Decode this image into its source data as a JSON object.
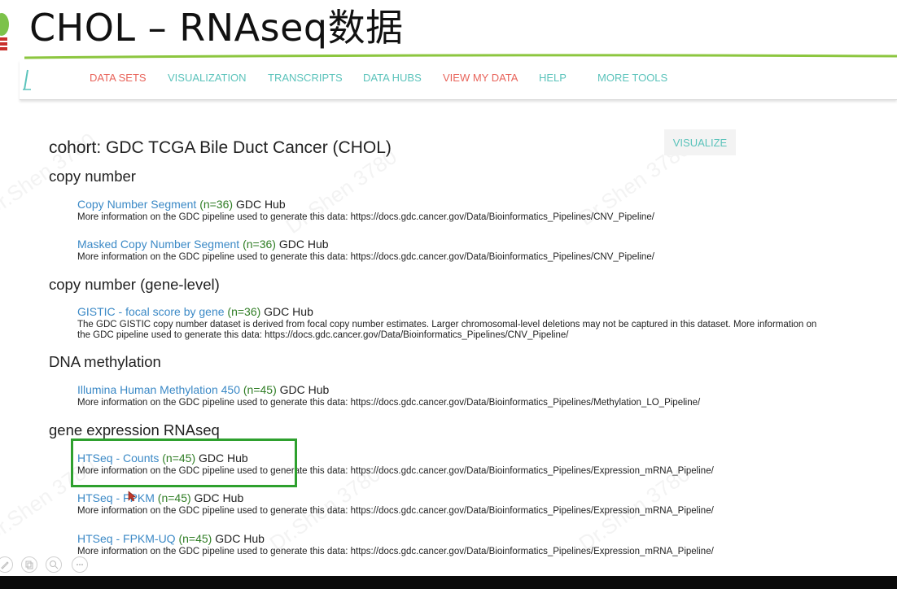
{
  "slide": {
    "title": "CHOL – RNAseq数据"
  },
  "nav": {
    "items": [
      {
        "label": "DATA SETS",
        "color": "#e8635a"
      },
      {
        "label": "VISUALIZATION",
        "color": "#5bc3bb"
      },
      {
        "label": "TRANSCRIPTS",
        "color": "#5bc3bb"
      },
      {
        "label": "DATA HUBS",
        "color": "#5bc3bb"
      },
      {
        "label": "VIEW MY DATA",
        "color": "#e8635a"
      },
      {
        "label": "HELP",
        "color": "#5bc3bb"
      },
      {
        "label": "MORE TOOLS",
        "color": "#5bc3bb"
      }
    ]
  },
  "main": {
    "visualize_label": "VISUALIZE",
    "cohort_title": "cohort: GDC TCGA Bile Duct Cancer (CHOL)",
    "sections": [
      {
        "title": "copy number",
        "datasets": [
          {
            "name": "Copy Number Segment",
            "count": "(n=36)",
            "hub": "GDC Hub",
            "desc": "More information on the GDC pipeline used to generate this data: https://docs.gdc.cancer.gov/Data/Bioinformatics_Pipelines/CNV_Pipeline/"
          },
          {
            "name": "Masked Copy Number Segment",
            "count": "(n=36)",
            "hub": "GDC Hub",
            "desc": "More information on the GDC pipeline used to generate this data: https://docs.gdc.cancer.gov/Data/Bioinformatics_Pipelines/CNV_Pipeline/"
          }
        ]
      },
      {
        "title": "copy number (gene-level)",
        "datasets": [
          {
            "name": "GISTIC - focal score by gene",
            "count": "(n=36)",
            "hub": "GDC Hub",
            "desc": "The GDC GISTIC copy number dataset is derived from focal copy number estimates. Larger chromosomal-level deletions may not be captured in this dataset. More information on the GDC pipeline used to generate this data: https://docs.gdc.cancer.gov/Data/Bioinformatics_Pipelines/CNV_Pipeline/"
          }
        ]
      },
      {
        "title": "DNA methylation",
        "datasets": [
          {
            "name": "Illumina Human Methylation 450",
            "count": "(n=45)",
            "hub": "GDC Hub",
            "desc": "More information on the GDC pipeline used to generate this data: https://docs.gdc.cancer.gov/Data/Bioinformatics_Pipelines/Methylation_LO_Pipeline/"
          }
        ]
      },
      {
        "title": "gene expression RNAseq",
        "datasets": [
          {
            "name": "HTSeq - Counts",
            "count": "(n=45)",
            "hub": "GDC Hub",
            "desc": "More information on the GDC pipeline used to generate this data: https://docs.gdc.cancer.gov/Data/Bioinformatics_Pipelines/Expression_mRNA_Pipeline/"
          },
          {
            "name": "HTSeq - FPKM",
            "count": "(n=45)",
            "hub": "GDC Hub",
            "desc": "More information on the GDC pipeline used to generate this data: https://docs.gdc.cancer.gov/Data/Bioinformatics_Pipelines/Expression_mRNA_Pipeline/"
          },
          {
            "name": "HTSeq - FPKM-UQ",
            "count": "(n=45)",
            "hub": "GDC Hub",
            "desc": "More information on the GDC pipeline used to generate this data: https://docs.gdc.cancer.gov/Data/Bioinformatics_Pipelines/Expression_mRNA_Pipeline/"
          }
        ]
      }
    ]
  },
  "watermark": "Dr.Shen 3780",
  "colors": {
    "link": "#3b89c6",
    "count": "#2f7d24",
    "highlight": "#2ea02e",
    "accent_teal": "#5bc3bb",
    "accent_red": "#e8635a"
  },
  "icons": {
    "toolbar": [
      "pen-icon",
      "copy-icon",
      "zoom-icon",
      "more-icon"
    ]
  }
}
